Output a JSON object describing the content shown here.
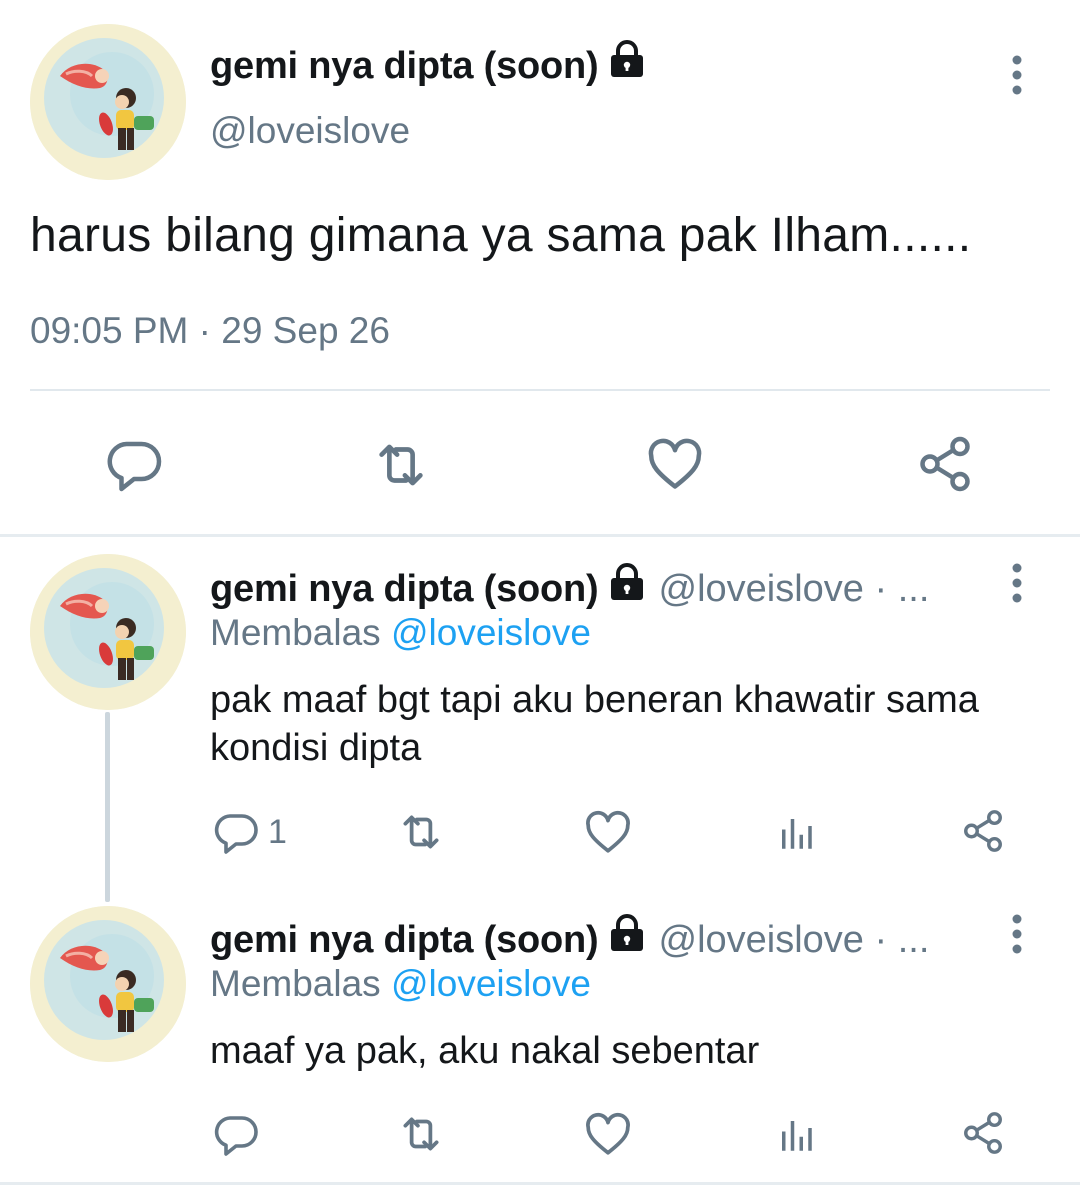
{
  "main_tweet": {
    "display_name": "gemi nya dipta (soon)",
    "handle": "@loveislove",
    "text": "harus bilang gimana ya sama pak Ilham......",
    "timestamp": "09:05 PM · 29 Sep 26",
    "protected_icon": "lock-icon",
    "actions": [
      {
        "name": "reply",
        "icon": "reply-icon"
      },
      {
        "name": "retweet",
        "icon": "retweet-icon"
      },
      {
        "name": "like",
        "icon": "heart-icon"
      },
      {
        "name": "share",
        "icon": "share-icon"
      }
    ]
  },
  "replies": [
    {
      "display_name": "gemi nya dipta (soon)",
      "handle": "@loveislove · ...",
      "replying_label": "Membalas",
      "replying_to": "@loveislove",
      "text": "pak maaf bgt tapi aku beneran khawatir sama kondisi dipta",
      "reply_count": "1"
    },
    {
      "display_name": "gemi nya dipta (soon)",
      "handle": "@loveislove · ...",
      "replying_label": "Membalas",
      "replying_to": "@loveislove",
      "text": "maaf ya pak, aku nakal sebentar",
      "reply_count": ""
    }
  ],
  "colors": {
    "text_primary": "#14171a",
    "text_secondary": "#657786",
    "link": "#1da1f2",
    "divider": "#e1e8ed",
    "icon": "#657786"
  }
}
